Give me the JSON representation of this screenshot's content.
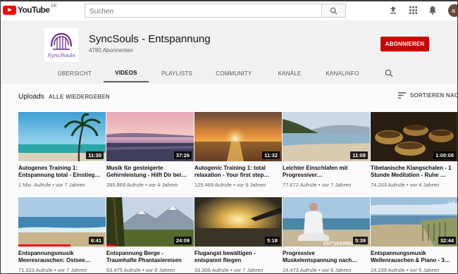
{
  "masthead": {
    "logo_text": "YouTube",
    "logo_country": "DE",
    "search_placeholder": "Suchen",
    "avatar_initial": "a"
  },
  "channel": {
    "name": "SyncSouls - Entspannung",
    "subscribers": "4780 Abonnenten",
    "subscribe_label": "ABONNIEREN",
    "logo_text": "SyncSouls",
    "accent_color": "#6b2f8f",
    "subscribe_color": "#cc0000"
  },
  "tabs": [
    {
      "label": "ÜBERSICHT",
      "active": false
    },
    {
      "label": "VIDEOS",
      "active": true
    },
    {
      "label": "PLAYLISTS",
      "active": false
    },
    {
      "label": "COMMUNITY",
      "active": false
    },
    {
      "label": "KANÄLE",
      "active": false
    },
    {
      "label": "KANALINFO",
      "active": false
    }
  ],
  "section": {
    "title": "Uploads",
    "play_all": "ALLE WIEDERGEBEN",
    "sort_label": "SORTIEREN NACH"
  },
  "videos": [
    {
      "title": "Autogenes Training 1: Entspannung total - Einstieg…",
      "views": "1 Mio. Aufrufe",
      "age": "vor 7 Jahren",
      "duration": "11:30",
      "watched": 0
    },
    {
      "title": "Musik für gesteigerte Gehirnleistung - Hilft Dir bei…",
      "views": "285.869 Aufrufe",
      "age": "vor 4 Jahren",
      "duration": "37:26",
      "watched": 0
    },
    {
      "title": "Autogenic Training 1: total relaxation - Your first step…",
      "views": "125.469 Aufrufe",
      "age": "vor 6 Jahren",
      "duration": "11:32",
      "watched": 0
    },
    {
      "title": "Leichter Einschlafen mit Progressiver…",
      "views": "77.672 Aufrufe",
      "age": "vor 7 Jahren",
      "duration": "11:08",
      "watched": 0
    },
    {
      "title": "Tibetanische Klangschalen - 1 Stunde Meditation - Ruhe …",
      "views": "74.203 Aufrufe",
      "age": "vor 4 Jahren",
      "duration": "1:00:08",
      "watched": 0
    },
    {
      "title": "Entspannungsmusik Meeresrauschen: Ostsee…",
      "views": "71.323 Aufrufe",
      "age": "vor 7 Jahren",
      "duration": "6:41",
      "watched": 0.6
    },
    {
      "title": "Entspannung Berge - Traumhafte Phantasiereisen",
      "views": "53.475 Aufrufe",
      "age": "vor 8 Jahren",
      "duration": "24:09",
      "watched": 0.1
    },
    {
      "title": "Flugangst bewältigen - entspannt fliegen",
      "views": "33.306 Aufrufe",
      "age": "vor 7 Jahren",
      "duration": "5:18",
      "watched": 0
    },
    {
      "title": "Progressive Muskelentspannung nach…",
      "views": "24.473 Aufrufe",
      "age": "vor 6 Jahren",
      "duration": "5:39",
      "watched": 0
    },
    {
      "title": "Entspannungsmusik Wellenrauschen & Piano - 3…",
      "views": "24.239 Aufrufe",
      "age": "vor 5 Jahren",
      "duration": "32:44",
      "watched": 0
    }
  ],
  "thumb_overlay_text": {
    "progressive": "ENTSPANNUNG",
    "waves": "2x5"
  },
  "separator": "•"
}
